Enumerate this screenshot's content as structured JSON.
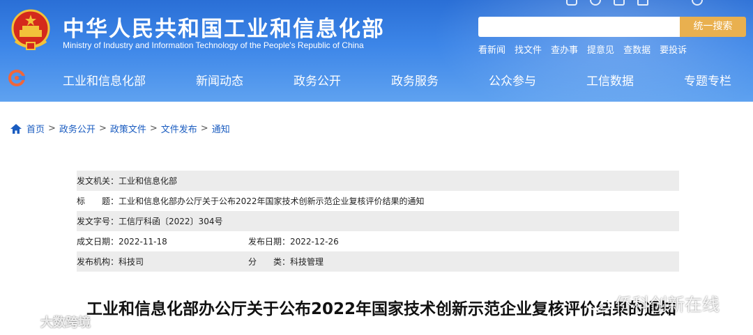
{
  "header": {
    "ministry_cn": "中华人民共和国工业和信息化部",
    "ministry_en": "Ministry of Industry and Information Technology of the People's Republic of China",
    "search_placeholder": "",
    "search_button": "统一搜索",
    "quick_links": [
      "看新闻",
      "找文件",
      "查办事",
      "提意见",
      "查数据",
      "要投诉"
    ],
    "icons": [
      "accessibility-icon",
      "weibo-icon",
      "mobile-icon",
      "mail-icon",
      "globe-icon"
    ]
  },
  "nav": {
    "items": [
      "工业和信息化部",
      "新闻动态",
      "政务公开",
      "政务服务",
      "公众参与",
      "工信数据",
      "专题专栏"
    ]
  },
  "breadcrumb": {
    "items": [
      "首页",
      "政务公开",
      "政策文件",
      "文件发布",
      "通知"
    ],
    "separator": ">"
  },
  "meta": {
    "issuer_label": "发文机关：",
    "issuer": "工业和信息化部",
    "title_label": "标　　题：",
    "title": "工业和信息化部办公厅关于公布2022年国家技术创新示范企业复核评价结果的通知",
    "docno_label": "发文字号：",
    "docno": "工信厅科函〔2022〕304号",
    "created_label": "成文日期：",
    "created": "2022-11-18",
    "published_label": "发布日期：",
    "published": "2022-12-26",
    "org_label": "发布机构：",
    "org": "科技司",
    "category_label": "分　　类：",
    "category": "科技管理"
  },
  "doc_title": "工业和信息化部办公厅关于公布2022年国家技术创新示范企业复核评价结果的通知",
  "watermarks": {
    "left": "大数跨境",
    "right": "侨科创新在线"
  },
  "colors": {
    "header_blue": "#3d86e8",
    "search_button": "#e9b04f",
    "link_blue": "#1a5cc0"
  }
}
